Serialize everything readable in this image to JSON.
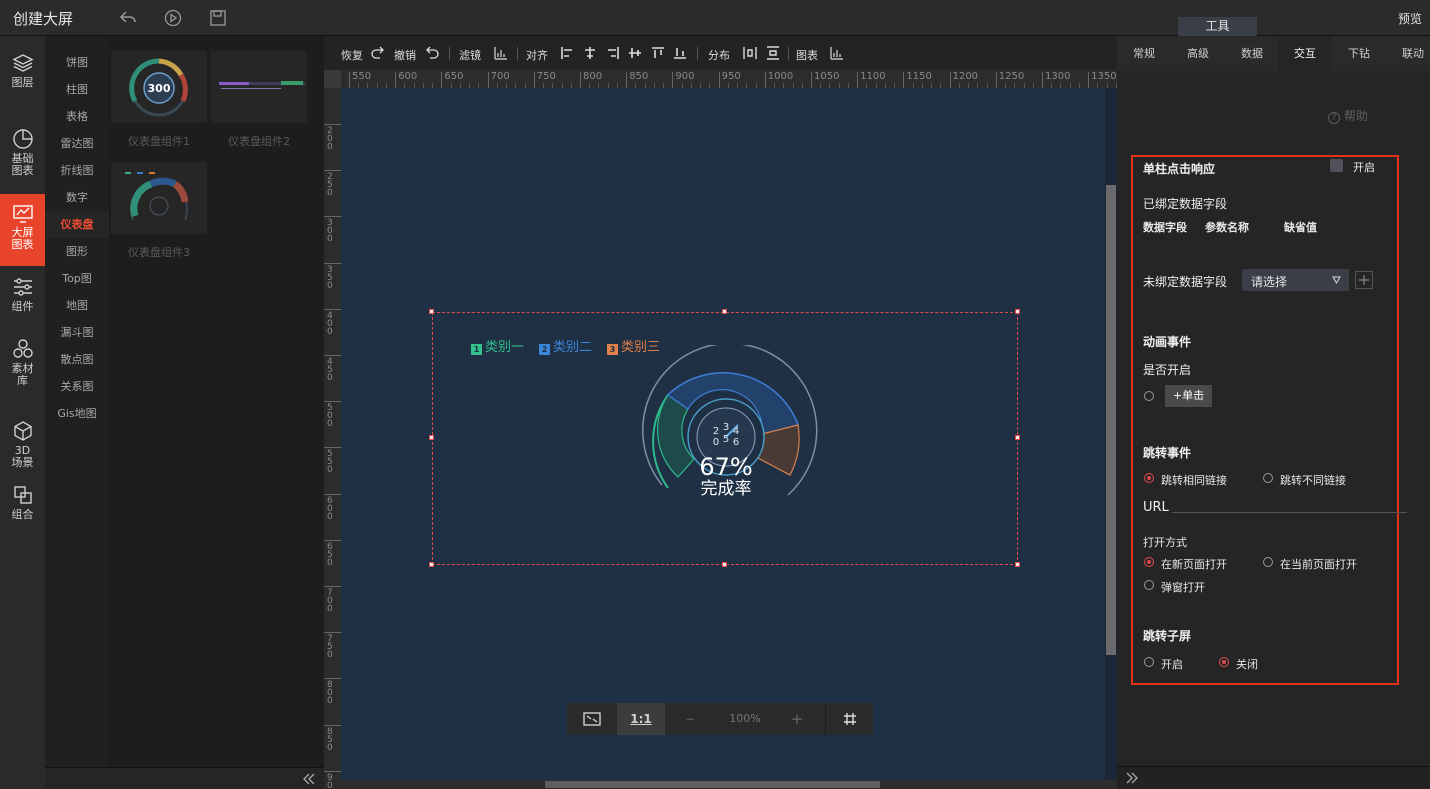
{
  "app": {
    "title": "创建大屏",
    "tools_tab": "工具",
    "preview": "预览"
  },
  "left_rail": [
    {
      "label": "图层",
      "icon": "layers-icon"
    },
    {
      "label": "基础图表",
      "icon": "pie-chart-icon"
    },
    {
      "label": "大屏图表",
      "icon": "screen-chart-icon",
      "active": true
    },
    {
      "label": "组件",
      "icon": "sliders-icon"
    },
    {
      "label": "素材库",
      "icon": "hexagons-icon"
    },
    {
      "label": "3D场景",
      "icon": "cube-icon"
    },
    {
      "label": "组合",
      "icon": "combine-icon"
    }
  ],
  "categories": [
    "饼图",
    "柱图",
    "表格",
    "雷达图",
    "折线图",
    "数字",
    "仪表盘",
    "图形",
    "Top图",
    "地图",
    "漏斗图",
    "散点图",
    "关系图",
    "Gis地图"
  ],
  "active_category": "仪表盘",
  "thumbnails": [
    {
      "label": "仪表盘组件1",
      "gauge_value": "300"
    },
    {
      "label": "仪表盘组件2"
    },
    {
      "label": "仪表盘组件3"
    }
  ],
  "toolbar": {
    "redo": "恢复",
    "undo": "撤销",
    "filter": "滤镜",
    "align": "对齐",
    "distribute": "分布",
    "chart": "图表"
  },
  "ruler_h": [
    "550",
    "600",
    "650",
    "700",
    "750",
    "800",
    "850",
    "900",
    "950",
    "1000",
    "1050",
    "1100",
    "1150",
    "1200",
    "1250",
    "1300",
    "1350"
  ],
  "ruler_v": [
    "200",
    "250",
    "300",
    "350",
    "400",
    "450",
    "500",
    "550",
    "600",
    "650",
    "700",
    "750",
    "800",
    "850",
    "900"
  ],
  "widget": {
    "legend": [
      {
        "label": "类别一",
        "color": "#33c08c",
        "glyph": "1"
      },
      {
        "label": "类别二",
        "color": "#3a86d8",
        "glyph": "2"
      },
      {
        "label": "类别三",
        "color": "#e0804a",
        "glyph": "3"
      }
    ],
    "percent": "67%",
    "caption": "完成率",
    "inner_ticks": [
      "2",
      "3",
      "4",
      "0",
      "5",
      "6"
    ]
  },
  "zoombar": {
    "fit": "fit-screen-icon",
    "ratio": "1:1",
    "minus": "−",
    "zoom": "100%",
    "plus": "+",
    "grid": "grid-icon"
  },
  "right_panel": {
    "tabs": [
      "常规",
      "高级",
      "数据",
      "交互",
      "下钻",
      "联动"
    ],
    "active_tab": "交互",
    "help": "帮助",
    "single_click": "单柱点击响应",
    "enable": "开启",
    "bound_fields": "已绑定数据字段",
    "col_field": "数据字段",
    "col_param": "参数名称",
    "col_default": "缺省值",
    "unbound_fields": "未绑定数据字段",
    "select_placeholder": "请选择",
    "anim_event": "动画事件",
    "is_open": "是否开启",
    "click_btn": "+单击",
    "jump_event": "跳转事件",
    "same_link": "跳转相同链接",
    "diff_link": "跳转不同链接",
    "url": "URL",
    "open_mode": "打开方式",
    "new_page": "在新页面打开",
    "current_page": "在当前页面打开",
    "popup": "弹窗打开",
    "jump_sub": "跳转子屏",
    "sub_on": "开启",
    "sub_off": "关闭"
  }
}
